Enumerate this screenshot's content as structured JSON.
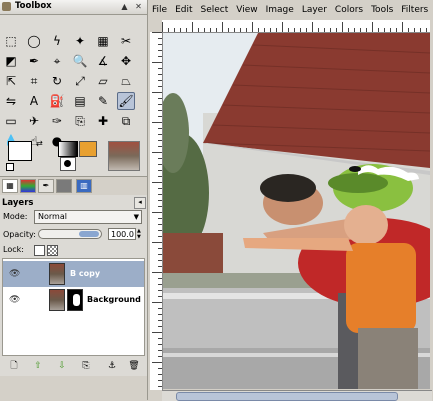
{
  "toolbox": {
    "title": "Toolbox",
    "controls": [
      "▲",
      "✕"
    ]
  },
  "tools": [
    {
      "name": "rect-select-icon",
      "g": "⬚"
    },
    {
      "name": "ellipse-select-icon",
      "g": "◯"
    },
    {
      "name": "lasso-icon",
      "g": "ϟ"
    },
    {
      "name": "fuzzy-select-icon",
      "g": "✦"
    },
    {
      "name": "color-select-icon",
      "g": "▦"
    },
    {
      "name": "scissors-icon",
      "g": "✂"
    },
    {
      "name": "foreground-select-icon",
      "g": "◩"
    },
    {
      "name": "paths-icon",
      "g": "✒"
    },
    {
      "name": "color-picker-icon",
      "g": "⌖"
    },
    {
      "name": "zoom-icon",
      "g": "🔍"
    },
    {
      "name": "measure-icon",
      "g": "∡"
    },
    {
      "name": "move-icon",
      "g": "✥"
    },
    {
      "name": "align-icon",
      "g": "⇱"
    },
    {
      "name": "crop-icon",
      "g": "⌗"
    },
    {
      "name": "rotate-icon",
      "g": "↻"
    },
    {
      "name": "scale-icon",
      "g": "⤢"
    },
    {
      "name": "shear-icon",
      "g": "▱"
    },
    {
      "name": "perspective-icon",
      "g": "⏢"
    },
    {
      "name": "flip-icon",
      "g": "⇋"
    },
    {
      "name": "text-icon",
      "g": "A"
    },
    {
      "name": "bucket-fill-icon",
      "g": "⛽"
    },
    {
      "name": "blend-icon",
      "g": "▤"
    },
    {
      "name": "pencil-icon",
      "g": "✎"
    },
    {
      "name": "paintbrush-icon",
      "g": "🖌"
    },
    {
      "name": "eraser-icon",
      "g": "▭"
    },
    {
      "name": "airbrush-icon",
      "g": "✈"
    },
    {
      "name": "ink-icon",
      "g": "✑"
    },
    {
      "name": "clone-icon",
      "g": "⎘"
    },
    {
      "name": "heal-icon",
      "g": "✚"
    },
    {
      "name": "perspective-clone-icon",
      "g": "⧉"
    },
    {
      "name": "blur-icon",
      "g": "💧"
    },
    {
      "name": "smudge-icon",
      "g": "☝"
    },
    {
      "name": "dodge-burn-icon",
      "g": "●"
    }
  ],
  "colors": {
    "foreground": "#ffffff",
    "background": "#000000"
  },
  "dock_tabs": [
    "layers-tab",
    "channels-tab",
    "paths-tab",
    "patterns-tab",
    "undo-tab"
  ],
  "layers": {
    "title": "Layers",
    "mode_label": "Mode:",
    "mode_value": "Normal",
    "opacity_label": "Opacity:",
    "opacity_value": "100.0",
    "lock_label": "Lock:",
    "items": [
      {
        "name": "B copy",
        "selected": true
      },
      {
        "name": "Background",
        "selected": false
      }
    ],
    "buttons": [
      "new-layer-icon",
      "raise-layer-icon",
      "lower-layer-icon",
      "duplicate-layer-icon",
      "anchor-layer-icon",
      "delete-layer-icon"
    ]
  },
  "image_window": {
    "menus": [
      "File",
      "Edit",
      "Select",
      "View",
      "Image",
      "Layer",
      "Colors",
      "Tools",
      "Filters"
    ]
  },
  "accent": "#9caec8"
}
